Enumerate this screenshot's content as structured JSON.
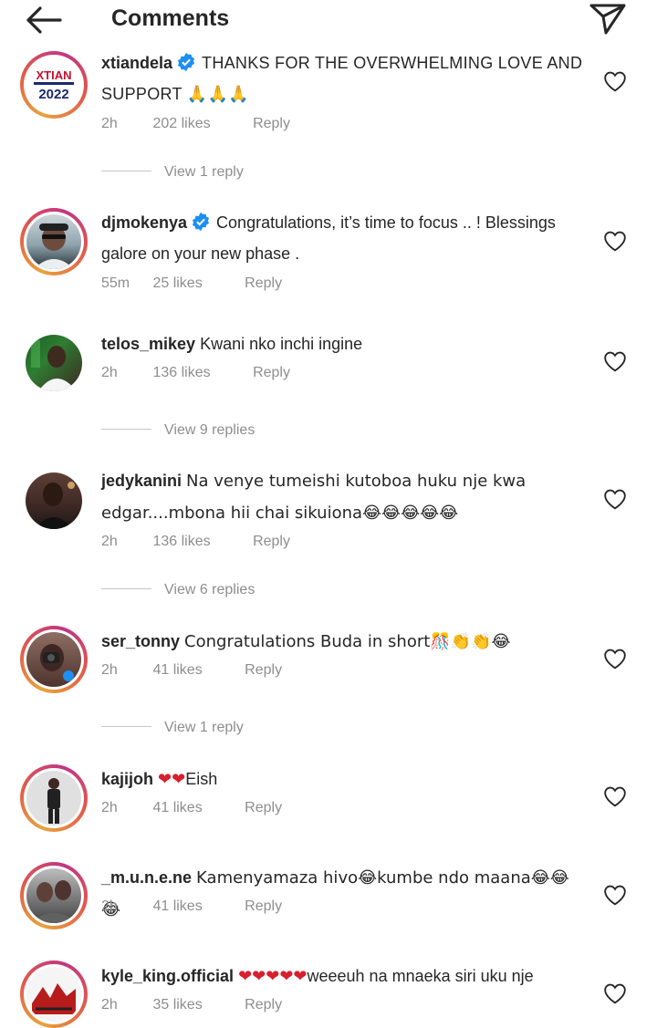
{
  "header": {
    "title": "Comments"
  },
  "comments": [
    {
      "username": "xtiandela",
      "verified": true,
      "text": "THANKS FOR THE OVERWHELMING LOVE AND SUPPORT 🙏🙏🙏",
      "time": "2h",
      "likes": "202 likes",
      "reply": "Reply",
      "view_replies": "View 1 reply",
      "avatar_label": "XTIAN 2022"
    },
    {
      "username": "djmokenya",
      "verified": true,
      "text": "Congratulations, it’s time to focus .. ! Blessings galore on your new phase .",
      "time": "55m",
      "likes": "25 likes",
      "reply": "Reply"
    },
    {
      "username": "telos_mikey",
      "text": "Kwani nko inchi ingine",
      "time": "2h",
      "likes": "136 likes",
      "reply": "Reply",
      "view_replies": "View 9 replies"
    },
    {
      "username": "jedykanini",
      "text": "Na venye tumeishi kutoboa huku nje kwa edgar....mbona hii chai sikuiona😂😂😂😂😂",
      "time": "2h",
      "likes": "136 likes",
      "reply": "Reply",
      "view_replies": "View 6 replies"
    },
    {
      "username": "ser_tonny",
      "text": "Congratulations Buda in short🎊👏👏😂",
      "time": "2h",
      "likes": "41 likes",
      "reply": "Reply",
      "view_replies": "View 1 reply"
    },
    {
      "username": "kajijoh",
      "hearts": "❤❤",
      "text": "Eish",
      "time": "2h",
      "likes": "41 likes",
      "reply": "Reply"
    },
    {
      "username": "_m.u.n.e.ne",
      "text": "Kamenyamaza hivo😂kumbe ndo maana😂😂😂",
      "time": "2h",
      "likes": "41 likes",
      "reply": "Reply"
    },
    {
      "username": "kyle_king.official",
      "hearts": "❤❤❤❤❤",
      "text": "weeeuh na mnaeka siri uku nje",
      "time": "2h",
      "likes": "35 likes",
      "reply": "Reply"
    }
  ],
  "colors": {
    "text": "#262626",
    "secondary": "#8e8e8e",
    "verified": "#1d8ff2",
    "heart_red": "#d91e2c"
  },
  "icons": [
    "back-arrow-icon",
    "send-icon",
    "verified-badge-icon",
    "heart-outline-icon"
  ]
}
